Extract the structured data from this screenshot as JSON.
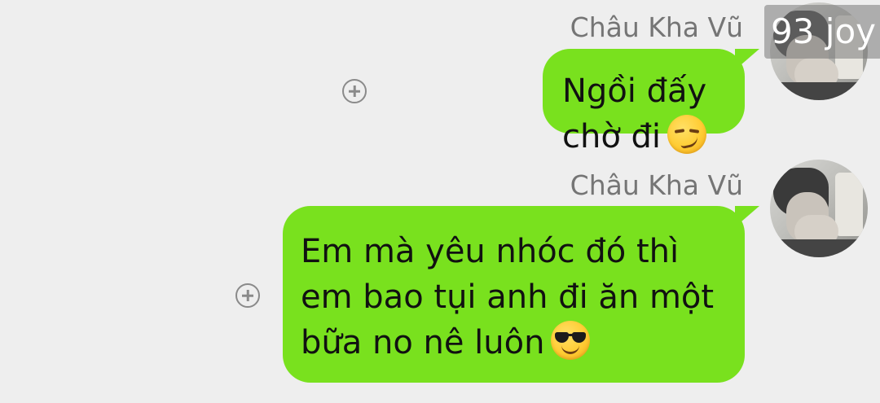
{
  "messages": [
    {
      "sender": "Châu Kha Vũ",
      "text": "Ngồi đấy chờ đi",
      "emoji": "smirking-face",
      "bubble_color": "#79e11e"
    },
    {
      "sender": "Châu Kha Vũ",
      "text": "Em mà yêu nhóc đó thì\nem bao tụi anh đi ăn một\nbữa no nê luôn",
      "emoji": "sunglasses-face",
      "bubble_color": "#79e11e"
    }
  ],
  "watermark": "93 joy",
  "colors": {
    "background": "#eeeeee",
    "bubble": "#79e11e",
    "sender_name": "#757575"
  }
}
